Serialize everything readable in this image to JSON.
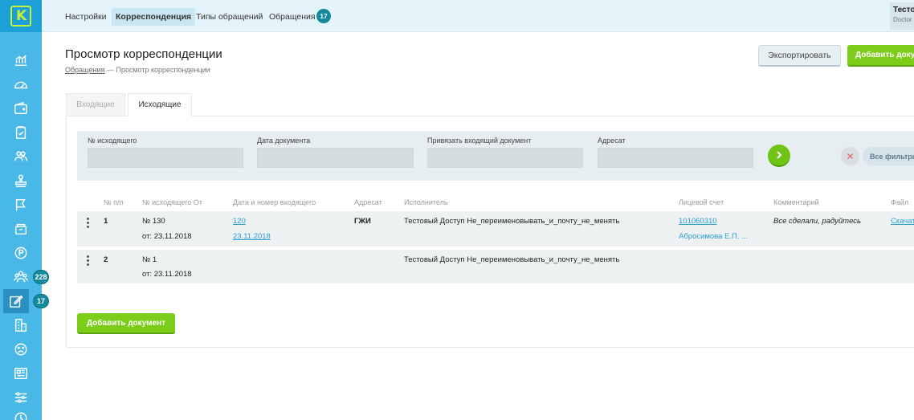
{
  "topnav": {
    "items": [
      "Настройки",
      "Корреспонденция",
      "Типы обращений",
      "Обращения"
    ],
    "appeals_badge": "17",
    "user_name": "Тестовый",
    "user_sub": "Doctor"
  },
  "sidebar": {
    "icons": [
      "chart-icon",
      "gauge-icon",
      "wallet-icon",
      "clipboard-icon",
      "people-icon",
      "stamp-icon",
      "flag-icon",
      "box-icon",
      "coin-icon",
      "users-group-icon",
      "edit-icon",
      "building-icon",
      "face-icon",
      "newspaper-icon",
      "sliders-icon",
      "history-icon"
    ],
    "badge_users": "228",
    "badge_edit": "17"
  },
  "header": {
    "title": "Просмотр корреспонденции",
    "breadcrumb_link": "Обращения",
    "breadcrumb_current": "— Просмотр корреспонденции",
    "export_label": "Экспортировать",
    "add_label": "Добавить документ"
  },
  "tabs": {
    "incoming": "Входящие",
    "outgoing": "Исходящие"
  },
  "filter": {
    "outgoing_no_label": "№ исходящего",
    "doc_date_label": "Дата документа",
    "link_incoming_label": "Привязать входящий документ",
    "addressee_label": "Адресат",
    "all_filters_label": "Все фильтры"
  },
  "table": {
    "columns": [
      "№ п/п",
      "№ исходящего От",
      "Дата и номер входящего",
      "Адресат",
      "Исполнитель",
      "Лицевой счет",
      "Комментарий",
      "Файл"
    ],
    "rows": [
      {
        "num": "1",
        "out_no": "№ 130",
        "out_date": "от: 23.11.2018",
        "in_no": "120",
        "in_date": "23.11.2018",
        "addressee": "ГЖИ",
        "executor": "Тестовый Доступ Не_переименовывать_и_почту_не_менять",
        "account": "101060310",
        "account_name": "Абросимова Е.П. ...",
        "comment": "Все сделали, радуйтесь",
        "file": "Скачать"
      },
      {
        "num": "2",
        "out_no": "№ 1",
        "out_date": "от: 23.11.2018",
        "in_no": "",
        "in_date": "",
        "addressee": "",
        "executor": "Тестовый Доступ Не_переименовывать_и_почту_не_менять",
        "account": "",
        "account_name": "",
        "comment": "",
        "file": ""
      }
    ]
  },
  "footer": {
    "add_label": "Добавить документ"
  },
  "colors": {
    "sidebar": "#49b8e6",
    "accent_green": "#7ccc1a",
    "badge": "#138a9e",
    "link": "#2a9fd0"
  }
}
